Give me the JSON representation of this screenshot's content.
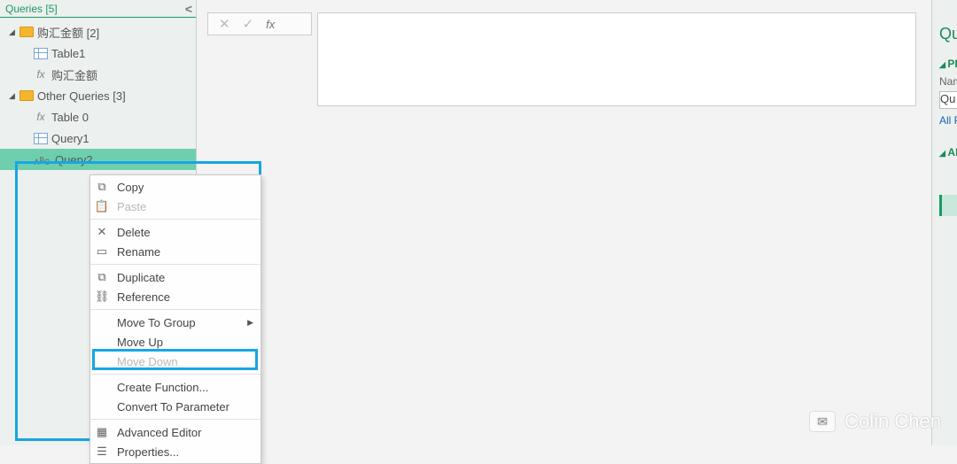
{
  "sidebar": {
    "header": "Queries [5]",
    "groups": [
      {
        "name": "购汇金额 [2]",
        "items": [
          {
            "icon": "table",
            "label": "Table1"
          },
          {
            "icon": "fx",
            "label": "购汇金额"
          }
        ]
      },
      {
        "name": "Other Queries [3]",
        "items": [
          {
            "icon": "fx",
            "label": "Table 0"
          },
          {
            "icon": "table",
            "label": "Query1"
          },
          {
            "icon": "abc",
            "label": "Query2",
            "selected": true
          }
        ]
      }
    ]
  },
  "context_menu": {
    "items": [
      {
        "icon": "copy",
        "label": "Copy"
      },
      {
        "icon": "paste",
        "label": "Paste",
        "disabled": true
      },
      {
        "sep": true
      },
      {
        "icon": "delete",
        "label": "Delete"
      },
      {
        "icon": "rename",
        "label": "Rename"
      },
      {
        "sep": true
      },
      {
        "icon": "duplicate",
        "label": "Duplicate"
      },
      {
        "icon": "reference",
        "label": "Reference"
      },
      {
        "sep": true
      },
      {
        "icon": "",
        "label": "Move To Group",
        "submenu": true
      },
      {
        "icon": "",
        "label": "Move Up"
      },
      {
        "icon": "",
        "label": "Move Down",
        "disabled": true
      },
      {
        "sep": true
      },
      {
        "icon": "",
        "label": "Create Function...",
        "highlight": true
      },
      {
        "icon": "",
        "label": "Convert To Parameter"
      },
      {
        "sep": true
      },
      {
        "icon": "editor",
        "label": "Advanced Editor"
      },
      {
        "icon": "props",
        "label": "Properties..."
      }
    ]
  },
  "formula_bar": {
    "cancel": "✕",
    "confirm": "✓",
    "fx": "fx",
    "value": "",
    "expand": "⌃"
  },
  "right_panel": {
    "title": "Que",
    "properties_section": "PRO",
    "name_label": "Nam",
    "name_value": "Qu",
    "all_link": "All P",
    "applied_section": "APP"
  },
  "watermark": {
    "text": "Colin Chen"
  }
}
